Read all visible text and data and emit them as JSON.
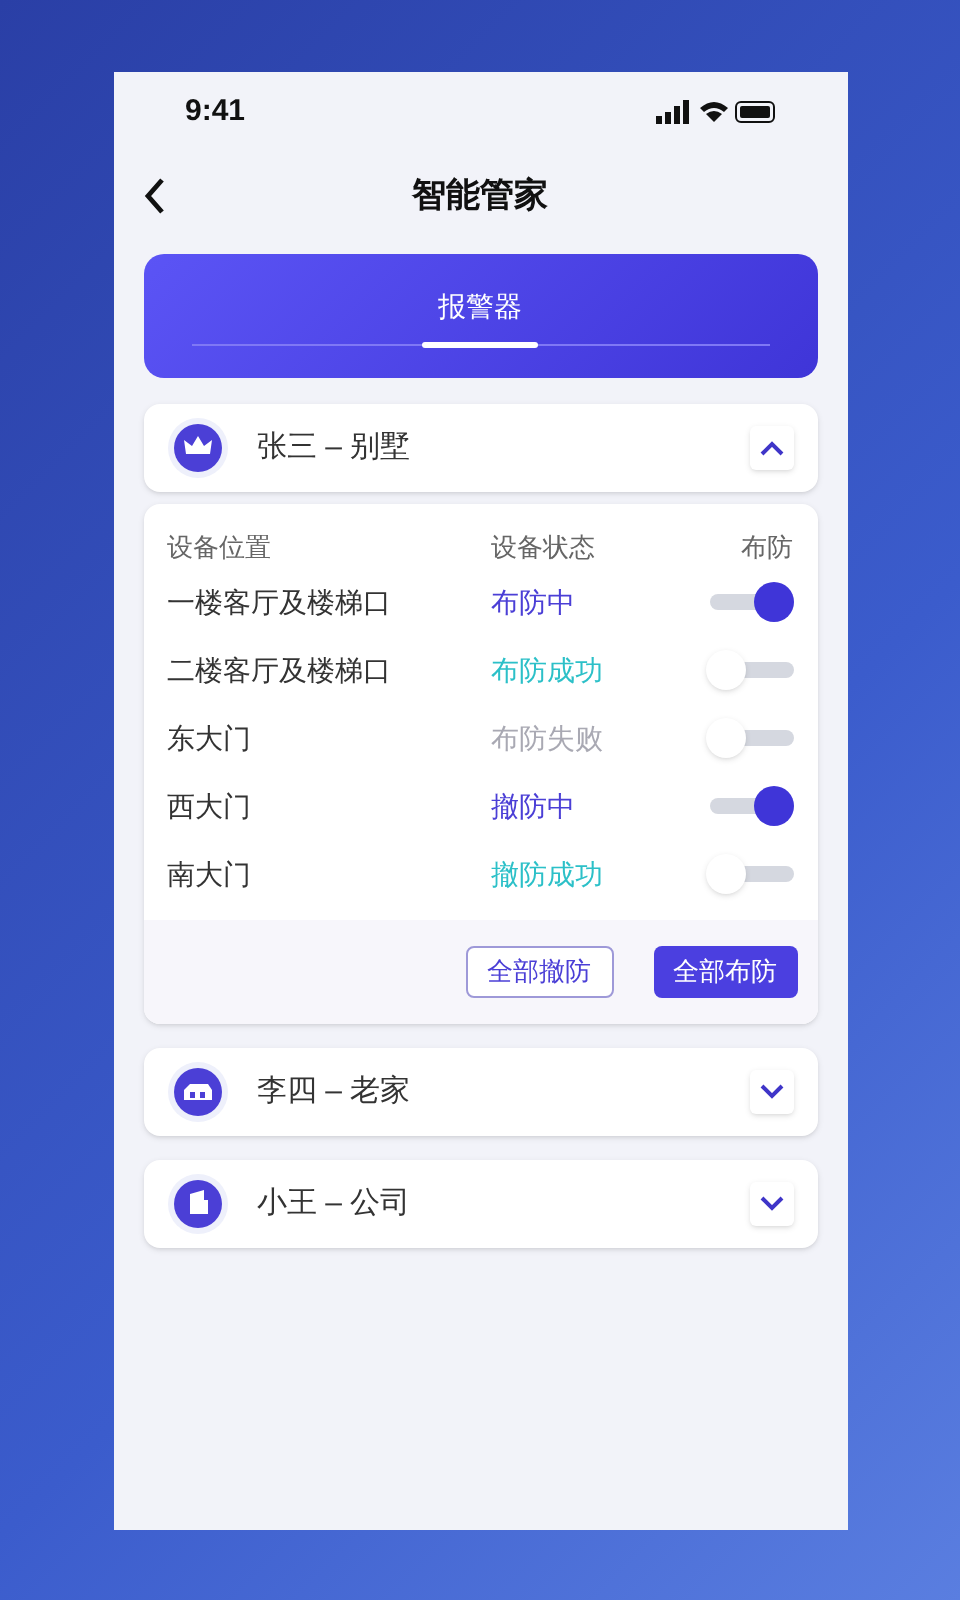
{
  "status_bar": {
    "time": "9:41"
  },
  "header": {
    "title": "智能管家"
  },
  "tabs": [
    {
      "label": "报警器",
      "selected": true
    }
  ],
  "sites": [
    {
      "name": "张三 – 别墅",
      "kind": "crown",
      "expanded": true,
      "columns": [
        "设备位置",
        "设备状态",
        "布防"
      ],
      "devices": [
        {
          "location": "一楼客厅及楼梯口",
          "status": "布防中",
          "kind": "pending",
          "on": true
        },
        {
          "location": "二楼客厅及楼梯口",
          "status": "布防成功",
          "kind": "success",
          "on": false
        },
        {
          "location": "东大门",
          "status": "布防失败",
          "kind": "failed",
          "on": false
        },
        {
          "location": "西大门",
          "status": "撤防中",
          "kind": "pending",
          "on": true
        },
        {
          "location": "南大门",
          "status": "撤防成功",
          "kind": "success",
          "on": false
        }
      ],
      "buttons": [
        {
          "label": "全部撤防",
          "kind": "outline"
        },
        {
          "label": "全部布防",
          "kind": "solid"
        }
      ]
    },
    {
      "name": "李四 – 老家",
      "kind": "house",
      "expanded": false
    },
    {
      "name": "小王 – 公司",
      "kind": "building",
      "expanded": false
    }
  ]
}
